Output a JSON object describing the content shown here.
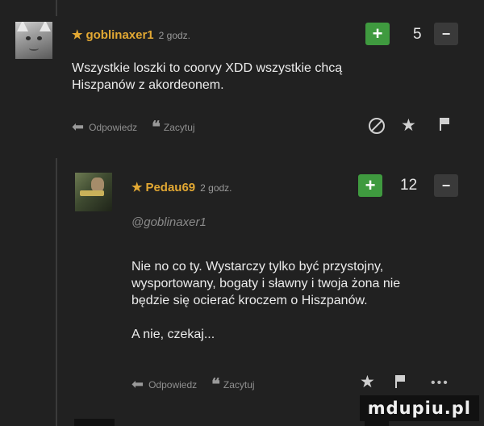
{
  "comments": [
    {
      "author": "goblinaxer1",
      "time": "2 godz.",
      "votes": "5",
      "plus": "+",
      "minus": "−",
      "lines": [
        "Wszystkie loszki to coorvy XDD wszystkie chcą",
        "Hiszpanów z akordeonem."
      ],
      "reply": "Odpowiedz",
      "quote": "Zacytuj"
    },
    {
      "author": "Pedau69",
      "time": "2 godz.",
      "votes": "12",
      "plus": "+",
      "minus": "−",
      "mention": "@goblinaxer1",
      "lines": [
        "Nie no co ty. Wystarczy tylko być przystojny,",
        "wysportowany, bogaty i sławny i twoja żona nie",
        "będzie się ocierać kroczem o Hiszpanów."
      ],
      "extra": "A nie, czekaj...",
      "reply": "Odpowiedz",
      "quote": "Zacytuj"
    }
  ],
  "icons": {
    "star": "★",
    "reply": "⬅",
    "quote": "❝",
    "more": "•••"
  },
  "colors": {
    "background": "#212121",
    "author": "#e2a833",
    "plus": "#3f9a3f",
    "minus": "#3a3a3a"
  },
  "watermark": "mdupiu.pl"
}
